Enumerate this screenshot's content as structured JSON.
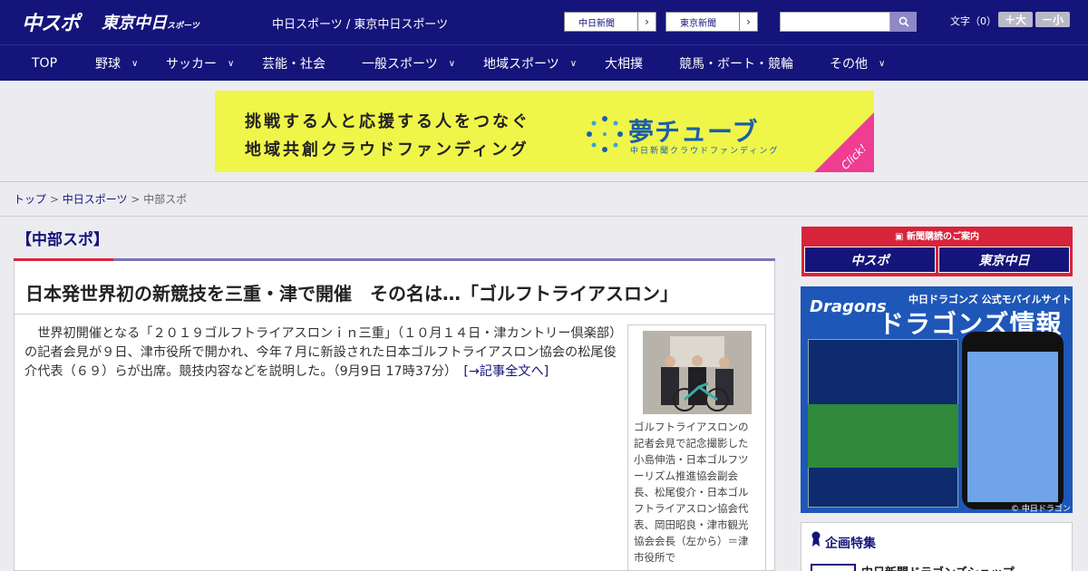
{
  "header": {
    "logo_main": "中スポ",
    "logo_tokyo": "東京中日",
    "logo_tokyo_small": "スポーツ",
    "site_name": "中日スポーツ / 東京中日スポーツ",
    "site_links": [
      "中日新聞",
      "東京新聞"
    ],
    "search_placeholder": "",
    "font_size_label": "文字（0）",
    "font_plus": "＋大",
    "font_minus": "－小"
  },
  "nav": [
    {
      "label": "TOP",
      "dropdown": false
    },
    {
      "label": "野球",
      "dropdown": true
    },
    {
      "label": "サッカー",
      "dropdown": true
    },
    {
      "label": "芸能・社会",
      "dropdown": false
    },
    {
      "label": "一般スポーツ",
      "dropdown": true
    },
    {
      "label": "地域スポーツ",
      "dropdown": true
    },
    {
      "label": "大相撲",
      "dropdown": false
    },
    {
      "label": "競馬・ボート・競輪",
      "dropdown": false
    },
    {
      "label": "その他",
      "dropdown": true
    }
  ],
  "banner": {
    "line1": "挑戦する人と応援する人をつなぐ",
    "line2": "地域共創クラウドファンディング",
    "brand": "夢チューブ",
    "brand_sub": "中日新聞クラウドファンディング",
    "click": "Click!"
  },
  "breadcrumb": {
    "top": "トップ",
    "sep": " > ",
    "level2": "中日スポーツ",
    "current": "中部スポ"
  },
  "article": {
    "section": "【中部スポ】",
    "headline": "日本発世界初の新競技を三重・津で開催　その名は…「ゴルフトライアスロン」",
    "body": "世界初開催となる「２０１９ゴルフトライアスロンｉｎ三重」（１０月１４日・津カントリー倶楽部）の記者会見が９日、津市役所で開かれ、今年７月に新設された日本ゴルフトライアスロン協会の松尾俊介代表（６９）らが出席。競技内容などを説明した。（9月9日 17時37分）",
    "read_more": "[→記事全文へ]",
    "caption": "ゴルフトライアスロンの記者会見で記念撮影した小島伸浩・日本ゴルフツーリズム推進協会副会長、松尾俊介・日本ゴルフトライアスロン協会代表、岡田昭良・津市観光協会会長（左から）＝津市役所で"
  },
  "sidebar": {
    "subscribe_header": "新聞購読のご案内",
    "subscribe_left": "中スポ",
    "subscribe_right": "東京中日",
    "dragons_logo": "Dragons",
    "dragons_sub": "中日ドラゴンズ 公式モバイルサイト",
    "dragons_title": "ドラゴンズ情報",
    "dragons_copy": "© 中日ドラゴンズ",
    "special_title": "企画特集",
    "special_item": "中日新聞ドラゴンズショップ"
  },
  "colors": {
    "header_bg": "#15147a",
    "accent_red": "#d8243b",
    "banner_yellow": "#f0f54a",
    "click_pink": "#ef3d91"
  }
}
